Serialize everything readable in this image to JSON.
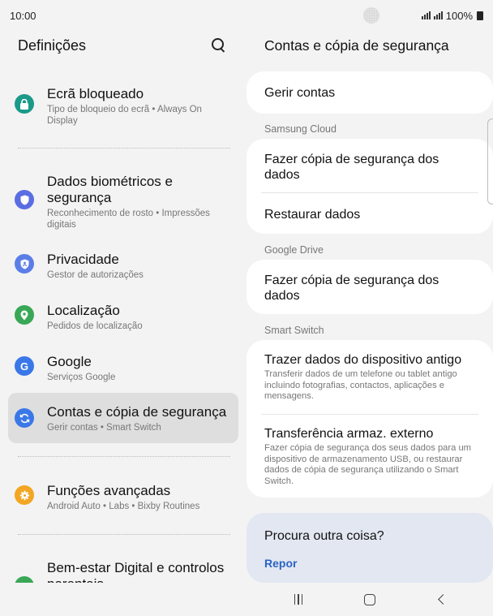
{
  "status": {
    "time": "10:00",
    "battery": "100%"
  },
  "left": {
    "title": "Definições",
    "items": [
      {
        "title": "Ecrã bloqueado",
        "subtitle": "Tipo de bloqueio do ecrã  •  Always On Display",
        "icon": "lock-icon",
        "color": "#1b9a8a"
      },
      {
        "title": "Dados biométricos e segurança",
        "subtitle": "Reconhecimento de rosto  •  Impressões digitais",
        "icon": "shield-icon",
        "color": "#5b6ee1"
      },
      {
        "title": "Privacidade",
        "subtitle": "Gestor de autorizações",
        "icon": "privacy-shield-icon",
        "color": "#5b7ee6"
      },
      {
        "title": "Localização",
        "subtitle": "Pedidos de localização",
        "icon": "location-pin-icon",
        "color": "#3aa757"
      },
      {
        "title": "Google",
        "subtitle": "Serviços Google",
        "icon": "google-icon",
        "color": "#3a78e8",
        "glyph": "G"
      },
      {
        "title": "Contas e cópia de segurança",
        "subtitle": "Gerir contas  •  Smart Switch",
        "icon": "sync-icon",
        "color": "#3a78e8"
      },
      {
        "title": "Funções avançadas",
        "subtitle": "Android Auto  •  Labs  •  Bixby Routines",
        "icon": "gear-star-icon",
        "color": "#f2a623"
      },
      {
        "title": "Bem-estar Digital e controlos parentais",
        "subtitle": "",
        "icon": "wellbeing-icon",
        "color": "#3aa757"
      }
    ]
  },
  "right": {
    "title": "Contas e cópia de segurança",
    "manage": "Gerir contas",
    "samsung_label": "Samsung Cloud",
    "samsung_backup": "Fazer cópia de segurança dos dados",
    "samsung_restore": "Restaurar dados",
    "google_label": "Google Drive",
    "google_backup": "Fazer cópia de segurança dos dados",
    "smart_label": "Smart Switch",
    "bring_title": "Trazer dados do dispositivo antigo",
    "bring_sub": "Transferir dados de um telefone ou tablet antigo incluindo fotografias, contactos, aplicações e mensagens.",
    "transfer_title": "Transferência armaz. externo",
    "transfer_sub": "Fazer cópia de segurança dos seus dados para um dispositivo de armazenamento USB, ou restaurar dados de cópia de segurança utilizando o Smart Switch.",
    "info_title": "Procura outra coisa?",
    "info_link": "Repor"
  }
}
